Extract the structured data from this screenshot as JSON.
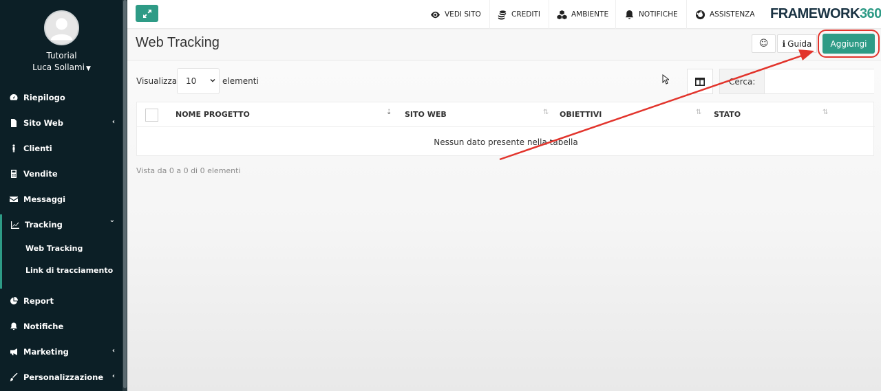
{
  "sidebar": {
    "org": "Tutorial",
    "user": "Luca Sollami",
    "items": [
      {
        "label": "Riepilogo",
        "icon": "dashboard-icon"
      },
      {
        "label": "Sito Web",
        "icon": "file-icon",
        "chevron": "‹"
      },
      {
        "label": "Clienti",
        "icon": "person-icon"
      },
      {
        "label": "Vendite",
        "icon": "calculator-icon"
      },
      {
        "label": "Messaggi",
        "icon": "envelope-icon"
      },
      {
        "label": "Tracking",
        "icon": "line-chart-icon",
        "chevron": "⌄"
      },
      {
        "label": "Report",
        "icon": "pie-chart-icon"
      },
      {
        "label": "Notifiche",
        "icon": "bell-icon"
      },
      {
        "label": "Marketing",
        "icon": "megaphone-icon",
        "chevron": "‹"
      },
      {
        "label": "Personalizzazione",
        "icon": "brush-icon",
        "chevron": "‹"
      }
    ],
    "tracking_sub": [
      "Web Tracking",
      "Link di tracciamento"
    ]
  },
  "topbar": {
    "vedi_sito": "VEDI SITO",
    "crediti": "CREDITI",
    "ambiente": "AMBIENTE",
    "notifiche": "NOTIFICHE",
    "assistenza": "ASSISTENZA",
    "brand_text": "FRAMEWORK",
    "brand_num": "360"
  },
  "header": {
    "title": "Web Tracking",
    "guida": "Guida",
    "aggiungi": "Aggiungi"
  },
  "controls": {
    "visualizza": "Visualizza",
    "page_size": "10",
    "elementi": "elementi",
    "cerca": "Cerca:"
  },
  "table": {
    "columns": [
      "NOME PROGETTO",
      "SITO WEB",
      "OBIETTIVI",
      "STATO"
    ],
    "empty": "Nessun dato presente nella tabella"
  },
  "info": "Vista da 0 a 0 di 0 elementi",
  "colors": {
    "accent": "#2e9b86",
    "sidebar": "#0c1f26",
    "annotation": "#e2342c"
  }
}
